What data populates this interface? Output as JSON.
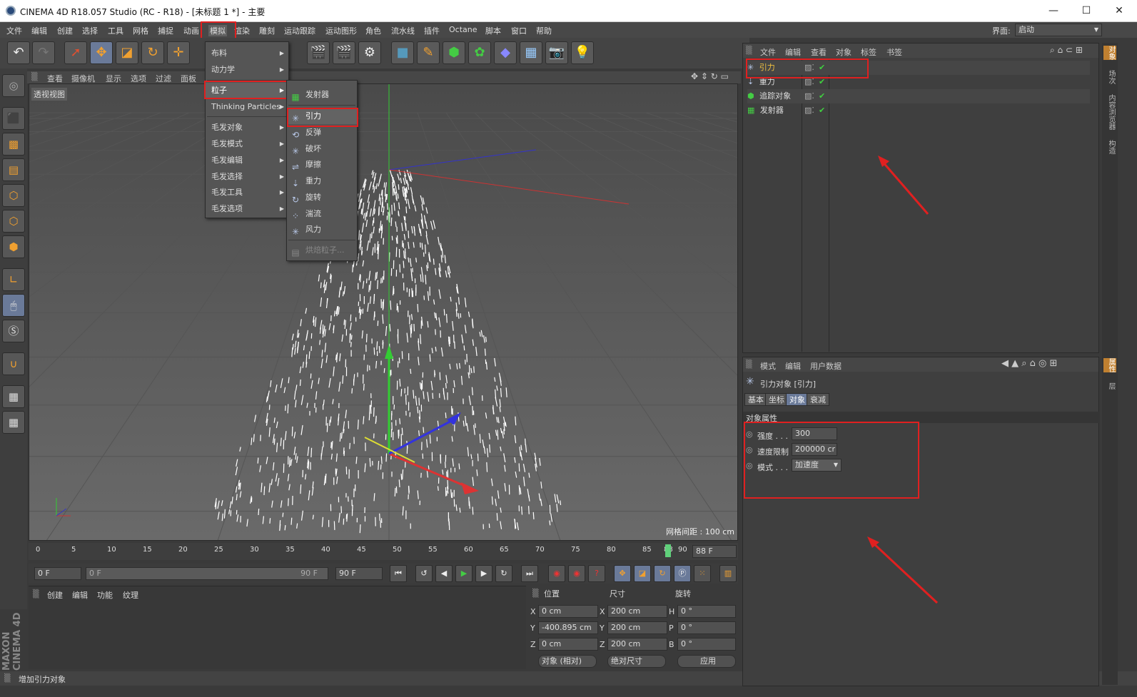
{
  "window": {
    "title": "CINEMA 4D R18.057 Studio (RC - R18) - [未标题 1 *] - 主要",
    "minimize": "—",
    "maximize": "☐",
    "close": "✕"
  },
  "menubar": {
    "items": [
      "文件",
      "编辑",
      "创建",
      "选择",
      "工具",
      "网格",
      "捕捉",
      "动画",
      "模拟",
      "渲染",
      "雕刻",
      "运动跟踪",
      "运动图形",
      "角色",
      "流水线",
      "插件",
      "Octane",
      "脚本",
      "窗口",
      "帮助"
    ],
    "layout_label": "界面:",
    "layout_value": "启动"
  },
  "simulate_menu": {
    "items": [
      "布料",
      "动力学",
      "粒子",
      "Thinking Particles",
      "毛发对象",
      "毛发模式",
      "毛发编辑",
      "毛发选择",
      "毛发工具",
      "毛发选项"
    ],
    "highlighted": "粒子"
  },
  "particle_menu": {
    "items": [
      "发射器",
      "引力",
      "反弹",
      "破坏",
      "摩擦",
      "重力",
      "旋转",
      "湍流",
      "风力",
      "烘焙粒子..."
    ],
    "highlighted": "引力"
  },
  "viewport": {
    "header_items": [
      "查看",
      "摄像机",
      "显示",
      "选项",
      "过滤",
      "面板"
    ],
    "view_name": "透视视图",
    "grid_spacing": "网格间距 : 100 cm"
  },
  "timeline": {
    "ticks": [
      "0",
      "5",
      "10",
      "15",
      "20",
      "25",
      "30",
      "35",
      "40",
      "45",
      "50",
      "55",
      "60",
      "65",
      "70",
      "75",
      "80",
      "85",
      "88",
      "90"
    ],
    "current_frame": "88 F",
    "start_field": "0 F",
    "range_start": "0 F",
    "range_end": "90 F",
    "end_field": "90 F"
  },
  "material_panel": {
    "items": [
      "创建",
      "编辑",
      "功能",
      "纹理"
    ]
  },
  "coord_panel": {
    "headers": [
      "位置",
      "尺寸",
      "旋转"
    ],
    "rows": [
      {
        "axis": "X",
        "pos": "0 cm",
        "size_axis": "X",
        "size": "200 cm",
        "rot_axis": "H",
        "rot": "0 °"
      },
      {
        "axis": "Y",
        "pos": "-400.895 cm",
        "size_axis": "Y",
        "size": "200 cm",
        "rot_axis": "P",
        "rot": "0 °"
      },
      {
        "axis": "Z",
        "pos": "0 cm",
        "size_axis": "Z",
        "size": "200 cm",
        "rot_axis": "B",
        "rot": "0 °"
      }
    ],
    "mode1": "对象 (相对)",
    "mode2": "绝对尺寸",
    "apply": "应用"
  },
  "status": "增加引力对象",
  "object_manager": {
    "menu": [
      "文件",
      "编辑",
      "查看",
      "对象",
      "标签",
      "书签"
    ],
    "objects": [
      "引力",
      "重力",
      "追踪对象",
      "发射器"
    ]
  },
  "attribute_manager": {
    "menu": [
      "模式",
      "编辑",
      "用户数据"
    ],
    "title": "引力对象 [引力]",
    "tabs": [
      "基本",
      "坐标",
      "对象",
      "衰减"
    ],
    "active_tab": "对象",
    "section": "对象属性",
    "props": [
      {
        "label": "强度 . . .",
        "value": "300"
      },
      {
        "label": "速度限制",
        "value": "200000 cr"
      },
      {
        "label": "模式 . . .",
        "value": "加速度"
      }
    ]
  },
  "right_tabs": [
    "对象",
    "场次",
    "内容浏览器",
    "构造",
    "属性",
    "层"
  ],
  "branding": "MAXON CINEMA 4D",
  "colors": {
    "highlight_red": "#e02020",
    "active_tab": "#6a7a99",
    "check_green": "#40d040",
    "object_orange": "#f0c040"
  }
}
